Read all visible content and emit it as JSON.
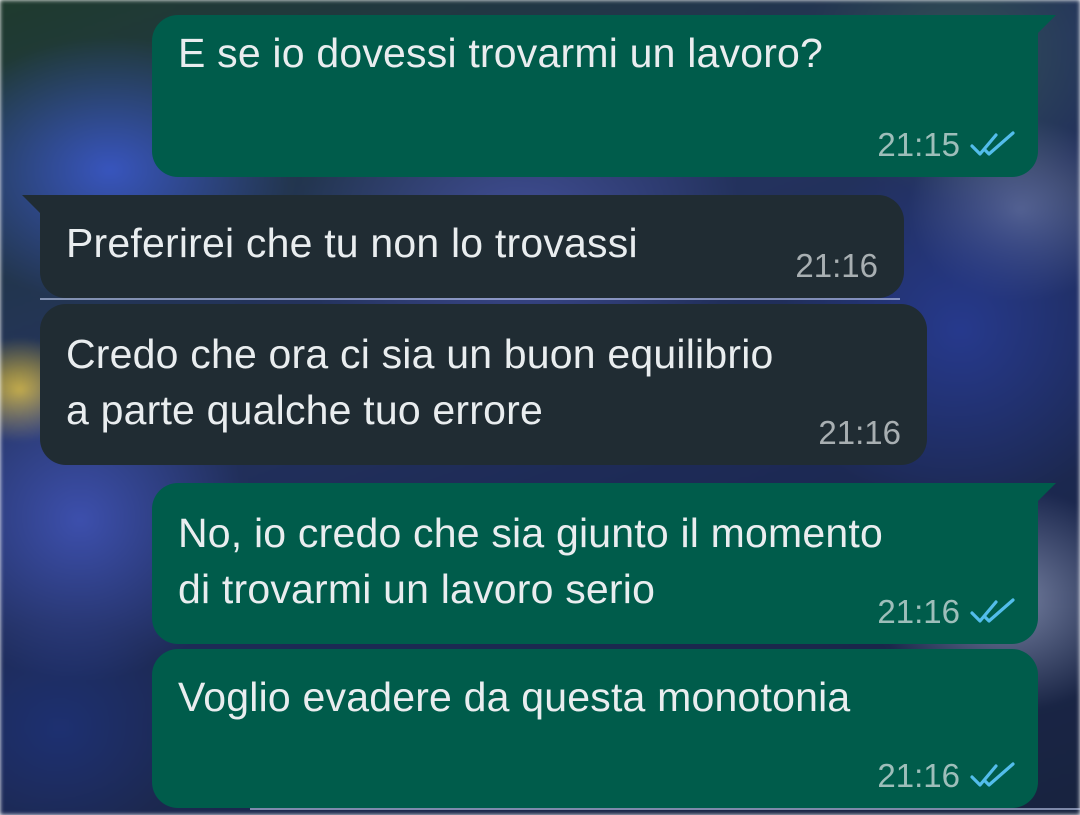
{
  "chat": {
    "messages": [
      {
        "direction": "outgoing",
        "lines": [
          "E se io dovessi trovarmi un lavoro?"
        ],
        "time": "21:15",
        "status": "read",
        "status_icon": "double-check-icon"
      },
      {
        "direction": "incoming",
        "lines": [
          "Preferirei che tu non lo trovassi"
        ],
        "time": "21:16"
      },
      {
        "direction": "incoming",
        "lines": [
          "Credo che ora ci sia un buon equilibrio",
          "a parte qualche tuo errore"
        ],
        "time": "21:16"
      },
      {
        "direction": "outgoing",
        "lines": [
          "No, io credo che sia giunto il momento",
          "di trovarmi un lavoro serio"
        ],
        "time": "21:16",
        "status": "read",
        "status_icon": "double-check-icon"
      },
      {
        "direction": "outgoing",
        "lines": [
          "Voglio evadere da questa monotonia"
        ],
        "time": "21:16",
        "status": "read",
        "status_icon": "double-check-icon"
      }
    ]
  },
  "colors": {
    "outgoing_bubble": "#005c4b",
    "incoming_bubble": "#202c33",
    "text": "#e9edef",
    "read_ticks": "#53bdeb"
  }
}
